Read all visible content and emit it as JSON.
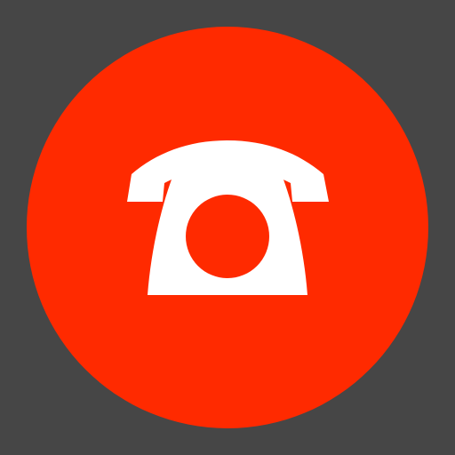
{
  "icon": {
    "name": "phone-icon",
    "background_color": "#464646",
    "circle_color": "#ff2a00",
    "glyph_color": "#ffffff"
  }
}
